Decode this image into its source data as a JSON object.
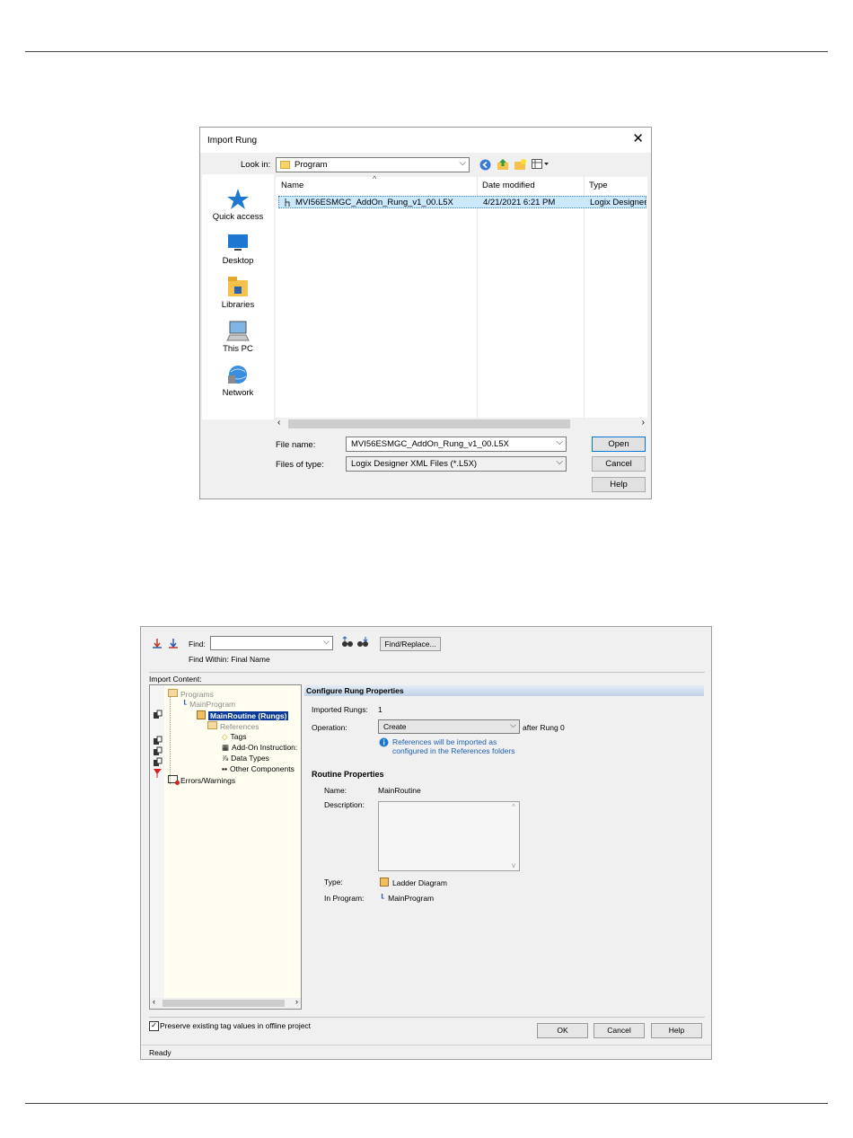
{
  "import_dialog": {
    "title": "Import Rung",
    "look_in_label": "Look in:",
    "look_in_value": "Program",
    "places": [
      {
        "label": "Quick access",
        "icon": "star-icon"
      },
      {
        "label": "Desktop",
        "icon": "desktop-icon"
      },
      {
        "label": "Libraries",
        "icon": "libraries-icon"
      },
      {
        "label": "This PC",
        "icon": "computer-icon"
      },
      {
        "label": "Network",
        "icon": "network-icon"
      }
    ],
    "columns": {
      "name": "Name",
      "date": "Date modified",
      "type": "Type"
    },
    "files": [
      {
        "name": "MVI56ESMGC_AddOn_Rung_v1_00.L5X",
        "date": "4/21/2021 6:21 PM",
        "type": "Logix Designer"
      }
    ],
    "file_name_label": "File name:",
    "file_name_value": "MVI56ESMGC_AddOn_Rung_v1_00.L5X",
    "file_type_label": "Files of type:",
    "file_type_value": "Logix Designer XML Files (*.L5X)",
    "open_label": "Open",
    "cancel_label": "Cancel",
    "help_label": "Help"
  },
  "import_config": {
    "find_label": "Find:",
    "find_value": "",
    "find_within": "Find Within: Final Name",
    "find_replace_label": "Find/Replace...",
    "import_content_label": "Import Content:",
    "tree": {
      "programs": "Programs",
      "main_program": "MainProgram",
      "main_routine": "MainRoutine (Rungs)",
      "references": "References",
      "tags": "Tags",
      "aoi": "Add-On Instruction:",
      "data_types": "Data Types",
      "other": "Other Components",
      "errors": "Errors/Warnings"
    },
    "configure_header": "Configure Rung Properties",
    "imported_rungs_label": "Imported Rungs:",
    "imported_rungs_value": "1",
    "operation_label": "Operation:",
    "operation_value": "Create",
    "after_rung": "after Rung 0",
    "info_line1": "References will be imported as",
    "info_line2": "configured in the References folders",
    "routine_header": "Routine Properties",
    "name_label": "Name:",
    "name_value": "MainRoutine",
    "description_label": "Description:",
    "type_label": "Type:",
    "type_value": "Ladder Diagram",
    "in_program_label": "In Program:",
    "in_program_value": "MainProgram",
    "preserve_label": "Preserve existing tag values in offline project",
    "ok_label": "OK",
    "cancel_label": "Cancel",
    "help_label": "Help",
    "status": "Ready"
  }
}
